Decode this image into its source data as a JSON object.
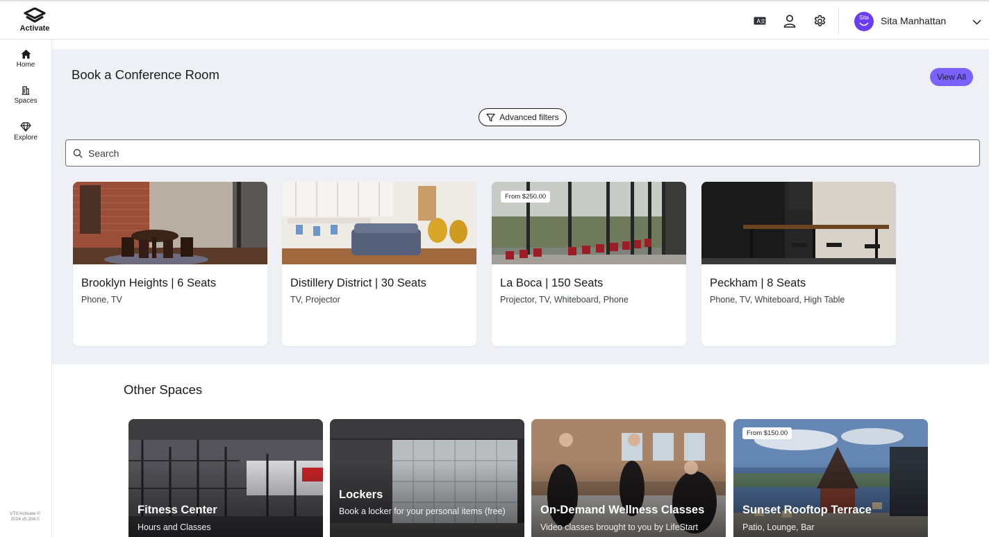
{
  "app": {
    "logo_text": "Activate"
  },
  "header": {
    "user_name": "Sita Manhattan",
    "avatar_text": "Sita"
  },
  "sidebar": {
    "items": [
      {
        "label": "Home",
        "icon": "home-icon"
      },
      {
        "label": "Spaces",
        "icon": "building-icon"
      },
      {
        "label": "Explore",
        "icon": "diamond-icon"
      }
    ],
    "version_text": "VTS Activate © 2024 v5.204.0"
  },
  "conference": {
    "title": "Book a Conference Room",
    "view_all_label": "View All",
    "advanced_filters_label": "Advanced filters",
    "search_placeholder": "Search",
    "rooms": [
      {
        "name": "Brooklyn Heights | 6 Seats",
        "amenities": "Phone, TV",
        "price": ""
      },
      {
        "name": "Distillery District | 30 Seats",
        "amenities": "TV, Projector",
        "price": ""
      },
      {
        "name": "La Boca | 150 Seats",
        "amenities": "Projector, TV, Whiteboard, Phone",
        "price": "From $250.00"
      },
      {
        "name": "Peckham | 8 Seats",
        "amenities": "Phone, TV, Whiteboard, High Table",
        "price": ""
      }
    ]
  },
  "other_spaces": {
    "title": "Other Spaces",
    "cards": [
      {
        "name": "Fitness Center",
        "desc": "Hours and Classes",
        "price": ""
      },
      {
        "name": "Lockers",
        "desc": "Book a locker for your personal items (free)",
        "price": ""
      },
      {
        "name": "On-Demand Wellness Classes",
        "desc": "Video classes brought to you by LifeStart",
        "price": ""
      },
      {
        "name": "Sunset Rooftop Terrace",
        "desc": "Patio, Lounge, Bar",
        "price": "From $150.00"
      }
    ]
  },
  "colors": {
    "accent": "#7b61ff",
    "avatar": "#6a3df5",
    "section_bg": "#eef0f5"
  }
}
